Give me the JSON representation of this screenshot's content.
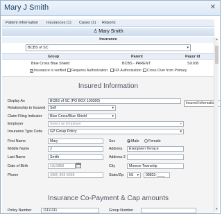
{
  "window": {
    "title": "Mary J Smith"
  },
  "tabs": [
    "Patient Information",
    "Insurances (1)",
    "Cases (1)",
    "Reports"
  ],
  "patient_name": "Mary Smith",
  "insurance": {
    "label": "Insurance",
    "selected": "BCBS of SC",
    "columns": [
      "Group",
      "Parent",
      "Payor Id"
    ],
    "row": [
      "Blue Cross Blue Shield",
      "BCBS - PARENT",
      "SX108"
    ],
    "checks": [
      {
        "label": "Insurance is verified",
        "checked": true
      },
      {
        "label": "Requires Authorization",
        "checked": false
      },
      {
        "label": "RX Authorization",
        "checked": false
      },
      {
        "label": "Cross Over from Primary",
        "checked": false
      }
    ]
  },
  "info": {
    "title": "Insured Information",
    "tooltip": "Insured Information",
    "display_as_label": "Display As",
    "display_as": "BCBS of SC (PO BOX 100300)",
    "relationship_label": "Relationship to Insured",
    "relationship": "Self",
    "claim_label": "Claim Filing Indicator",
    "claim": "Blue Cross/Blue Shield",
    "employer_label": "Employer",
    "employer_placeholder": "Select an Employer",
    "type_label": "Insurance Type Code",
    "type": "GP Group Policy",
    "first_label": "First Name",
    "first": "Mary",
    "middle_label": "Middle Name",
    "middle": "J",
    "last_label": "Last Name",
    "last": "Smith",
    "dob_label": "Date of Birth",
    "dob": "1/1/1950",
    "phone_label": "Phone",
    "phone_placeholder": "(888) 888-8888",
    "sex_label": "Sex",
    "sex_male": "Male",
    "sex_female": "Female",
    "sex_selected": "Male",
    "address_label": "Address",
    "address": "Evergreen Terrace",
    "address2_label": "Address 2",
    "city_label": "City",
    "city": "Monroe Township",
    "statezip_label": "State/Zip",
    "state": "NJ",
    "zip": "08831-____"
  },
  "copay": {
    "title": "Insurance Co-Payment & Cap amounts",
    "policy_label": "Policy Number",
    "policy": "11111111",
    "group_label": "Group Number"
  }
}
